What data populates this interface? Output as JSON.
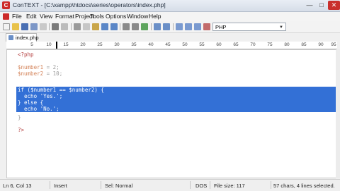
{
  "window": {
    "title": "ConTEXT - [C:\\xampp\\htdocs\\series\\operators\\index.php]",
    "min_label": "—",
    "max_label": "□",
    "close_label": "✕",
    "app_icon_glyph": "C"
  },
  "menu": {
    "items": [
      "File",
      "Edit",
      "View",
      "Format",
      "Project",
      "Tools",
      "Options",
      "Window",
      "Help"
    ]
  },
  "toolbar": {
    "language_value": "PHP"
  },
  "tab": {
    "label": "index.php"
  },
  "ruler": {
    "marks": [
      "5",
      "10",
      "15",
      "20",
      "25",
      "30",
      "35",
      "40",
      "45",
      "50",
      "55",
      "60",
      "65",
      "70",
      "75",
      "80",
      "85",
      "90",
      "95"
    ]
  },
  "code": {
    "line1": "<?php",
    "line3a": "$number1",
    "line3b": " = 2;",
    "line4a": "$number2",
    "line4b": " = 10;",
    "line6": "if ($number1 == $number2) {",
    "line7": "  echo 'Yes.';",
    "line8": "} else {",
    "line9": "  echo 'No.';",
    "line10": "}",
    "line12": "?>"
  },
  "status": {
    "position": "Ln 6, Col 13",
    "mode": "Insert",
    "selection": "Sel: Normal",
    "format": "DOS",
    "filesize": "File size: 117",
    "selected_info": "57 chars, 4 lines selected."
  },
  "colors": {
    "selection": "#3370d6",
    "keyword": "#1e43c6",
    "variable": "#d4845a",
    "php_tag": "#b33c3c"
  }
}
